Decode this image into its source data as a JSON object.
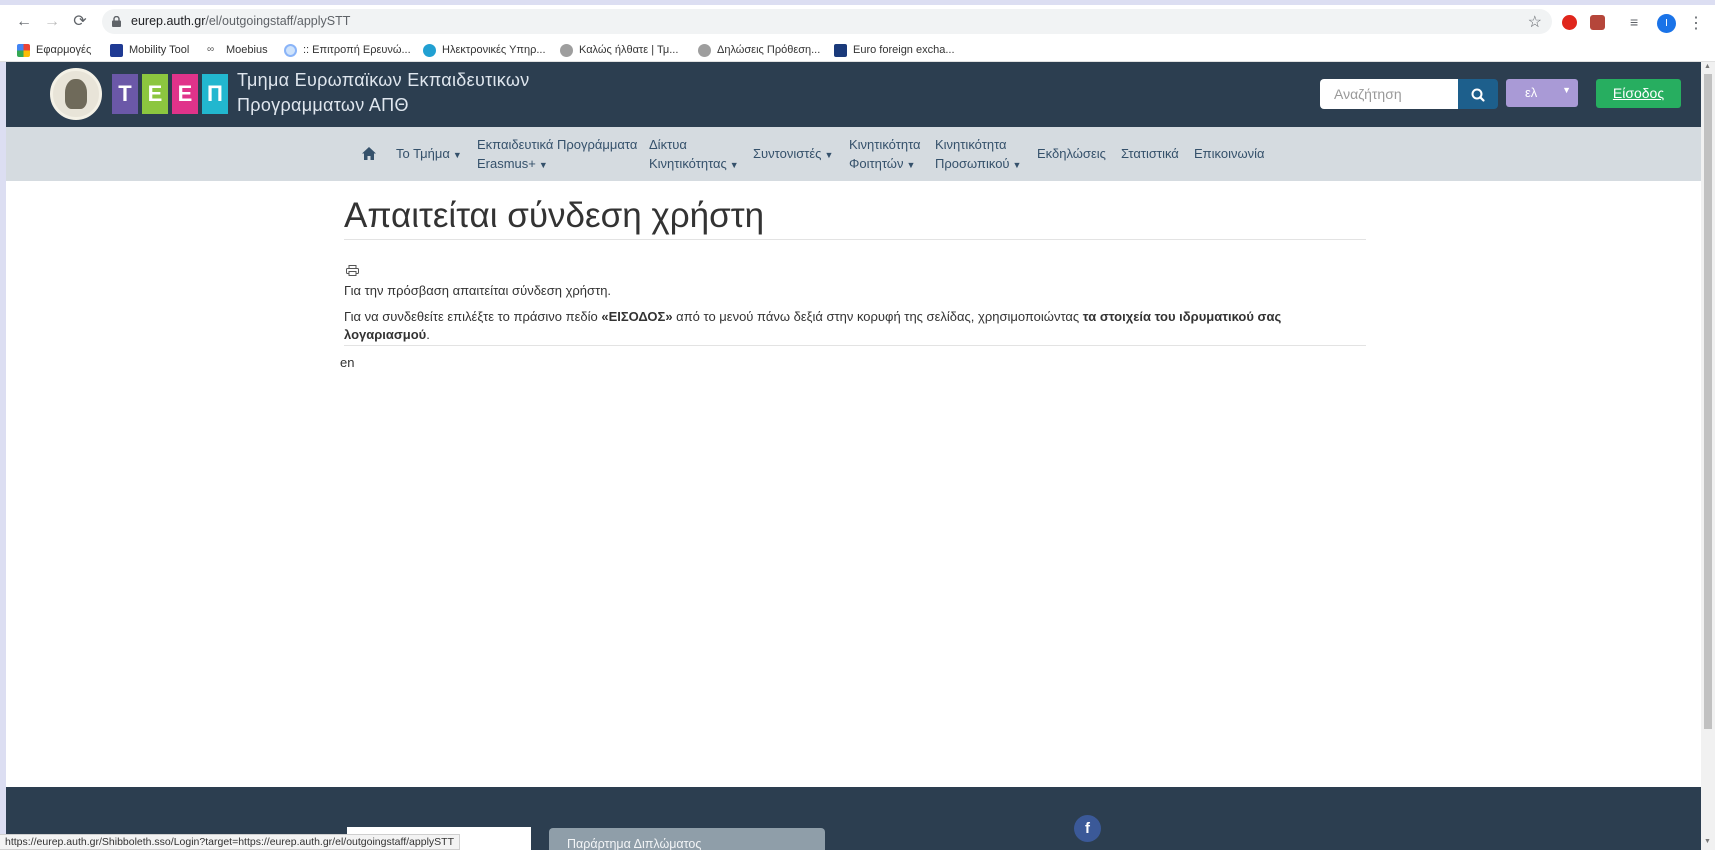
{
  "browser": {
    "url_host": "eurep.auth.gr",
    "url_path": "/el/outgoingstaff/applySTT",
    "profile_initial": "I",
    "status_url": "https://eurep.auth.gr/Shibboleth.sso/Login?target=https://eurep.auth.gr/el/outgoingstaff/applySTT"
  },
  "bookmarks": [
    {
      "label": "Εφαρμογές",
      "icon": "apps-grid-icon",
      "color": "#4285f4"
    },
    {
      "label": "Mobility Tool",
      "icon": "eu-flag-icon",
      "color": "#1f3a93"
    },
    {
      "label": "Moebius",
      "icon": "moebius-icon",
      "color": "#777777"
    },
    {
      "label": ":: Επιτροπή Ερευνώ...",
      "icon": "globe-icon",
      "color": "#8ab4f8"
    },
    {
      "label": "Ηλεκτρονικές Υπηρ...",
      "icon": "service-icon",
      "color": "#21a0d2"
    },
    {
      "label": "Καλώς ήλθατε | Τμ...",
      "icon": "seal-icon",
      "color": "#9e9e9e"
    },
    {
      "label": "Δηλώσεις Πρόθεση...",
      "icon": "seal-icon",
      "color": "#9e9e9e"
    },
    {
      "label": "Euro foreign excha...",
      "icon": "ecb-icon",
      "color": "#1a3a7a"
    }
  ],
  "site": {
    "logo_letters": [
      "Τ",
      "Ε",
      "Ε",
      "Π"
    ],
    "logo_colors": [
      "#6b58a8",
      "#8cc63f",
      "#e0338a",
      "#22b7cf"
    ],
    "dept_line1": "Τμημα Ευρωπαϊκων Εκπαιδευτικων",
    "dept_line2": "Προγραμματων ΑΠΘ",
    "search_placeholder": "Αναζήτηση",
    "lang": "ελ",
    "login": "Είσοδος"
  },
  "nav": {
    "items": [
      {
        "label": "Το Τμήμα",
        "dropdown": true
      },
      {
        "label": "Εκπαιδευτικά Προγράμματα",
        "label2": "Erasmus+",
        "dropdown": true
      },
      {
        "label": "Δίκτυα",
        "label2": "Κινητικότητας",
        "dropdown": true
      },
      {
        "label": "Συντονιστές",
        "dropdown": true
      },
      {
        "label": "Κινητικότητα",
        "label2": "Φοιτητών",
        "dropdown": true
      },
      {
        "label": "Κινητικότητα",
        "label2": "Προσωπικού",
        "dropdown": true
      },
      {
        "label": "Εκδηλώσεις",
        "dropdown": false
      },
      {
        "label": "Στατιστικά",
        "dropdown": false
      },
      {
        "label": "Επικοινωνία",
        "dropdown": false
      }
    ]
  },
  "main": {
    "title": "Απαιτείται σύνδεση χρήστη",
    "p1": "Για την πρόσβαση απαιτείται σύνδεση χρήστη.",
    "p2_a": "Για να συνδεθείτε επιλέξτε το πράσινο πεδίο ",
    "p2_b": "«ΕΙΣΟΔΟΣ»",
    "p2_c": " από το μενού πάνω δεξιά στην κορυφή της σελίδας, χρησιμοποιώντας ",
    "p2_d": "τα στοιχεία του ιδρυματικού σας λογαριασμού",
    "p2_e": ".",
    "lang_link": "en"
  },
  "footer": {
    "annex_button": "Παράρτημα Διπλώματος",
    "facebook": "f"
  }
}
